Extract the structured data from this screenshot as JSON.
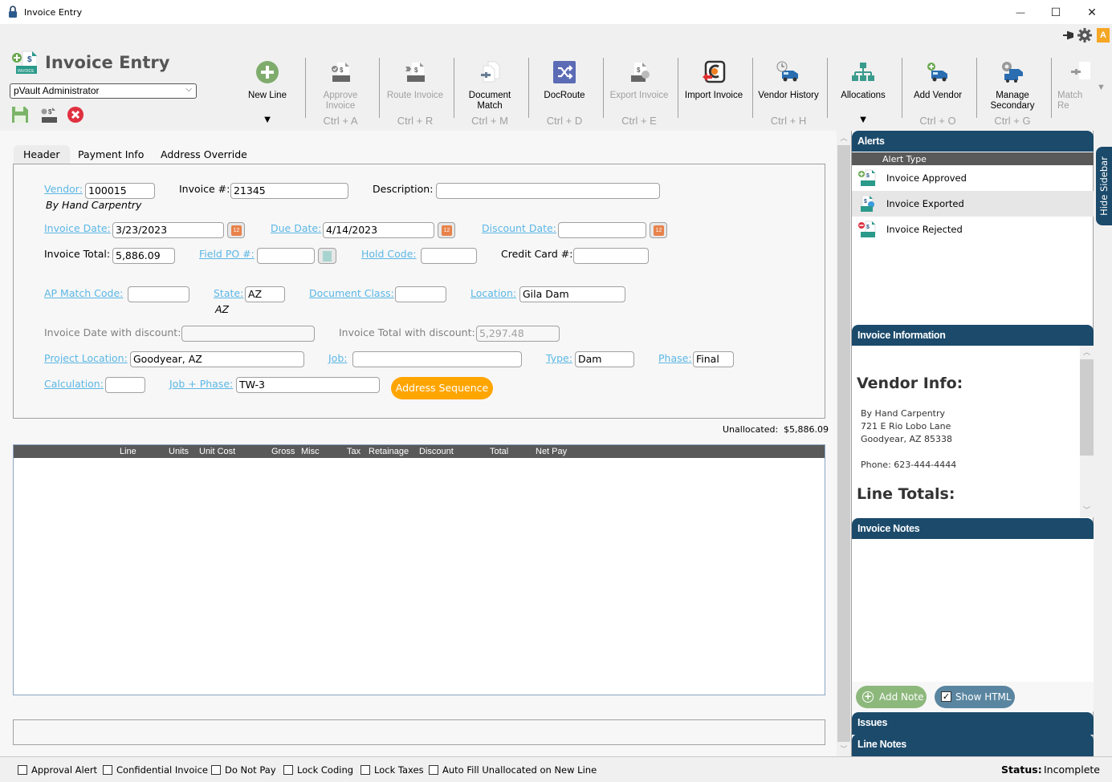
{
  "window": {
    "title": "Invoice Entry",
    "minimize": "—",
    "maximize": "☐",
    "close": "✕"
  },
  "header": {
    "app_title": "Invoice Entry",
    "user_select": "pVault Administrator"
  },
  "toolbar": [
    {
      "label": "New Line",
      "shortcut": "",
      "dropdown": true,
      "enabled": true
    },
    {
      "label": "Approve Invoice",
      "shortcut": "Ctrl + A",
      "enabled": false
    },
    {
      "label": "Route Invoice",
      "shortcut": "Ctrl + R",
      "enabled": false
    },
    {
      "label": "Document Match",
      "shortcut": "Ctrl + M",
      "enabled": true
    },
    {
      "label": "DocRoute",
      "shortcut": "Ctrl + D",
      "enabled": true
    },
    {
      "label": "Export Invoice",
      "shortcut": "Ctrl + E",
      "enabled": false
    },
    {
      "label": "Import Invoice",
      "shortcut": "",
      "enabled": true
    },
    {
      "label": "Vendor History",
      "shortcut": "Ctrl + H",
      "enabled": true
    },
    {
      "label": "Allocations",
      "shortcut": "",
      "dropdown": true,
      "enabled": true
    },
    {
      "label": "Add Vendor",
      "shortcut": "Ctrl + O",
      "enabled": true
    },
    {
      "label": "Manage Secondary",
      "shortcut": "Ctrl + G",
      "enabled": true
    },
    {
      "label": "Match Re",
      "shortcut": "",
      "enabled": false
    }
  ],
  "tabs": [
    "Header",
    "Payment Info",
    "Address Override"
  ],
  "form": {
    "vendor": {
      "label": "Vendor:",
      "value": "100015",
      "name": "By Hand Carpentry"
    },
    "invoice_no": {
      "label": "Invoice #:",
      "value": "21345"
    },
    "description": {
      "label": "Description:",
      "value": ""
    },
    "invoice_date": {
      "label": "Invoice Date:",
      "value": "3/23/2023"
    },
    "due_date": {
      "label": "Due Date:",
      "value": "4/14/2023"
    },
    "discount_date": {
      "label": "Discount Date:",
      "value": ""
    },
    "invoice_total": {
      "label": "Invoice Total:",
      "value": "5,886.09"
    },
    "field_po": {
      "label": "Field PO #:",
      "value": ""
    },
    "hold_code": {
      "label": "Hold Code:",
      "value": ""
    },
    "credit_card": {
      "label": "Credit Card #:",
      "value": ""
    },
    "ap_match_code": {
      "label": "AP Match Code:",
      "value": ""
    },
    "state": {
      "label": "State:",
      "value": "AZ",
      "sub": "AZ"
    },
    "document_class": {
      "label": "Document Class:",
      "value": ""
    },
    "location": {
      "label": "Location:",
      "value": "Gila Dam"
    },
    "invoice_date_discount": {
      "label": "Invoice Date with discount:",
      "value": ""
    },
    "invoice_total_discount": {
      "label": "Invoice Total with discount:",
      "value": "5,297.48"
    },
    "project_location": {
      "label": "Project Location:",
      "value": "Goodyear, AZ"
    },
    "job": {
      "label": "Job:",
      "value": ""
    },
    "type": {
      "label": "Type:",
      "value": "Dam"
    },
    "phase": {
      "label": "Phase:",
      "value": "Final"
    },
    "calculation": {
      "label": "Calculation:",
      "value": ""
    },
    "job_phase": {
      "label": "Job + Phase:",
      "value": "TW-3"
    },
    "address_sequence_button": "Address Sequence",
    "calendar_day": "12"
  },
  "unallocated": {
    "label": "Unallocated:",
    "value": "$5,886.09"
  },
  "grid": {
    "columns": [
      "Line",
      "Units",
      "Unit Cost",
      "Gross",
      "Misc",
      "Tax",
      "Retainage",
      "Discount",
      "Total",
      "Net Pay"
    ]
  },
  "sidebar": {
    "hide_label": "Hide Sidebar",
    "alerts": {
      "title": "Alerts",
      "column": "Alert Type",
      "items": [
        "Invoice Approved",
        "Invoice Exported",
        "Invoice Rejected"
      ]
    },
    "invoice_info": {
      "title": "Invoice Information",
      "vendor_heading": "Vendor Info:",
      "vendor_name": "By Hand Carpentry",
      "address1": "721 E Rio Lobo Lane",
      "address2": "Goodyear, AZ 85338",
      "phone": "Phone: 623-444-4444",
      "line_totals_heading": "Line Totals:"
    },
    "notes": {
      "title": "Invoice Notes",
      "add_note": "Add Note",
      "show_html": "Show HTML",
      "show_html_checked": true
    },
    "issues_title": "Issues",
    "line_notes_title": "Line Notes"
  },
  "footer": {
    "checkboxes": [
      {
        "label": "Approval Alert",
        "checked": false
      },
      {
        "label": "Confidential Invoice",
        "checked": false
      },
      {
        "label": "Do Not Pay",
        "checked": false
      },
      {
        "label": "Lock Coding",
        "checked": false
      },
      {
        "label": "Lock Taxes",
        "checked": false
      },
      {
        "label": "Auto Fill Unallocated on New Line",
        "checked": false
      }
    ],
    "status_label": "Status:",
    "status_value": "Incomplete"
  },
  "colors": {
    "accent_navy": "#1b4a6b",
    "link": "#5bb7e5",
    "orange": "#ffa500",
    "add_green": "#8db87c",
    "show_html_blue": "#5a85a0"
  }
}
